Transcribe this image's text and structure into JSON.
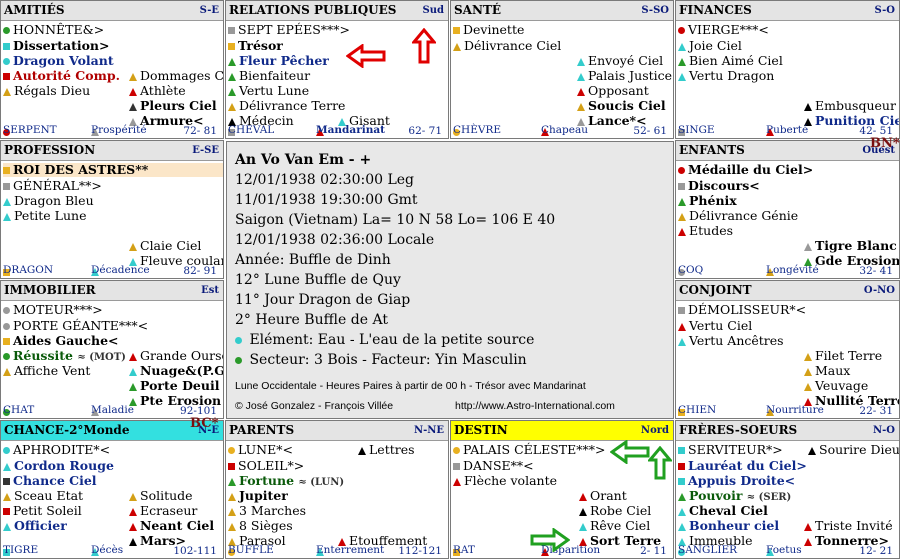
{
  "cells": {
    "amities": {
      "name": "AMITIÉS",
      "dir": "S-E",
      "lines": [
        "HONNÊTE&>",
        "Dissertation>",
        "Dragon Volant",
        "Autorité Comp.",
        "Régals Dieu",
        "Dommages C",
        "Athlète",
        "Pleurs Ciel",
        "Armure<"
      ],
      "foot": [
        "SERPENT",
        "Prospérité",
        "72- 81"
      ]
    },
    "relations": {
      "name": "RELATIONS PUBLIQUES",
      "dir": "Sud",
      "lines": [
        "SEPT EPÉES***>",
        "Trésor",
        "Fleur Pêcher",
        "Bienfaiteur",
        "Vertu Lune",
        "Délivrance Terre",
        "Médecin",
        "Gisant"
      ],
      "foot": [
        "CHEVAL",
        "Mandarinat",
        "62- 71"
      ]
    },
    "sante": {
      "name": "SANTÉ",
      "dir": "S-SO",
      "lines": [
        "Devinette",
        "Délivrance Ciel",
        "Envoyé Ciel",
        "Palais Justice",
        "Opposant",
        "Soucis Ciel",
        "Lance*<"
      ],
      "foot": [
        "CHÈVRE",
        "Chapeau",
        "52- 61"
      ]
    },
    "finances": {
      "name": "FINANCES",
      "dir": "S-O",
      "lines": [
        "VIERGE***<",
        "Joie Ciel",
        "Bien Aimé Ciel",
        "Vertu Dragon",
        "Embusqueur",
        "Punition Ciel"
      ],
      "foot": [
        "SINGE",
        "Puberté",
        "42- 51"
      ]
    },
    "profession": {
      "name": "PROFESSION",
      "dir": "E-SE",
      "lines": [
        "ROI DES ASTRES**",
        "GÉNÉRAL**>",
        "Dragon Bleu",
        "Petite Lune",
        "Claie Ciel",
        "Fleuve coulant"
      ],
      "foot": [
        "DRAGON",
        "Décadence",
        "82- 91"
      ]
    },
    "enfants": {
      "name": "ENFANTS",
      "dir": "Ouest",
      "lines": [
        "Médaille du Ciel>",
        "Discours<",
        "Phénix",
        "Délivrance Génie",
        "Etudes",
        "Tigre Blanc",
        "Gde Erosion"
      ],
      "foot": [
        "COQ",
        "Longévité",
        "32- 41"
      ]
    },
    "immobilier": {
      "name": "IMMOBILIER",
      "dir": "Est",
      "lines": [
        "MOTEUR***>",
        "PORTE GÉANTE***<",
        "Aides Gauche<",
        "Réussite",
        "(MOT)",
        "Affiche Vent",
        "Grande Ourse",
        "Nuage&(P.G)",
        "Porte Deuil",
        "Pte Erosion"
      ],
      "foot": [
        "CHAT",
        "Maladie",
        "92-101"
      ]
    },
    "conjoint": {
      "name": "CONJOINT",
      "dir": "O-NO",
      "lines": [
        "DÉMOLISSEUR*<",
        "Vertu Ciel",
        "Vertu Ancêtres",
        "Filet Terre",
        "Maux",
        "Veuvage",
        "Nullité Terre"
      ],
      "foot": [
        "CHIEN",
        "Nourriture",
        "22- 31"
      ]
    },
    "chance": {
      "name": "CHANCE-2°Monde",
      "dir": "N-E",
      "lines": [
        "APHRODITE*<",
        "Cordon Rouge",
        "Chance Ciel",
        "Sceau Etat",
        "Petit Soleil",
        "Officier",
        "Solitude",
        "Ecraseur",
        "Neant Ciel",
        "Mars>"
      ],
      "foot": [
        "TIGRE",
        "Décès",
        "102-111"
      ]
    },
    "parents": {
      "name": "PARENTS",
      "dir": "N-NE",
      "lines": [
        "LUNE*<",
        "SOLEIL*>",
        "Fortune",
        "(LUN)",
        "Jupiter",
        "3 Marches",
        "8 Sièges",
        "Parasol",
        "Lettres",
        "Etouffement"
      ],
      "foot": [
        "BUFFLE",
        "Enterrement",
        "112-121"
      ]
    },
    "destin": {
      "name": "DESTIN",
      "dir": "Nord",
      "lines": [
        "PALAIS CÉLESTE***>",
        "DANSE**<",
        "Flèche volante",
        "Orant",
        "Robe Ciel",
        "Rêve Ciel",
        "Sort Terre"
      ],
      "foot": [
        "RAT",
        "Disparition",
        "2- 11"
      ]
    },
    "freres": {
      "name": "FRÈRES-SOEURS",
      "dir": "N-O",
      "lines": [
        "SERVITEUR*>",
        "Lauréat du Ciel>",
        "Appuis Droite<",
        "Pouvoir",
        "(SER)",
        "Cheval Ciel",
        "Bonheur ciel",
        "Immeuble",
        "Sourire Dieu",
        "Triste Invité",
        "Tonnerre>"
      ],
      "foot": [
        "SANGLIER",
        "Foetus",
        "12- 21"
      ]
    }
  },
  "center": {
    "lines": [
      "An Vo Van Em  - +",
      "12/01/1938 02:30:00 Leg",
      "11/01/1938 19:30:00 Gmt",
      "Saigon (Vietnam) La= 10 N 58   Lo= 106 E 40",
      "12/01/1938 02:36:00 Locale",
      "Année: Buffle de Dinh",
      "12° Lune Buffle de Quy",
      "11° Jour Dragon de Giap",
      " 2° Heure Buffle de At",
      "Elément: Eau  - L'eau de la petite source",
      "Secteur: 3 Bois    -    Facteur: Yin Masculin"
    ],
    "note": "Lune Occidentale  -  Heures  Paires  à partir de 00 h  -   Trésor avec  Mandarinat",
    "credit": "©  José Gonzalez  -  François Villée",
    "url": "http://www.Astro-International.com"
  },
  "corners": {
    "bn": "BN*",
    "bc": "BC*"
  },
  "colors": {
    "header": "#e4e4e4",
    "destin": "#ffff00",
    "chance": "#33e0e0",
    "red_arrow": "#e00000",
    "green_arrow": "#20a020"
  }
}
